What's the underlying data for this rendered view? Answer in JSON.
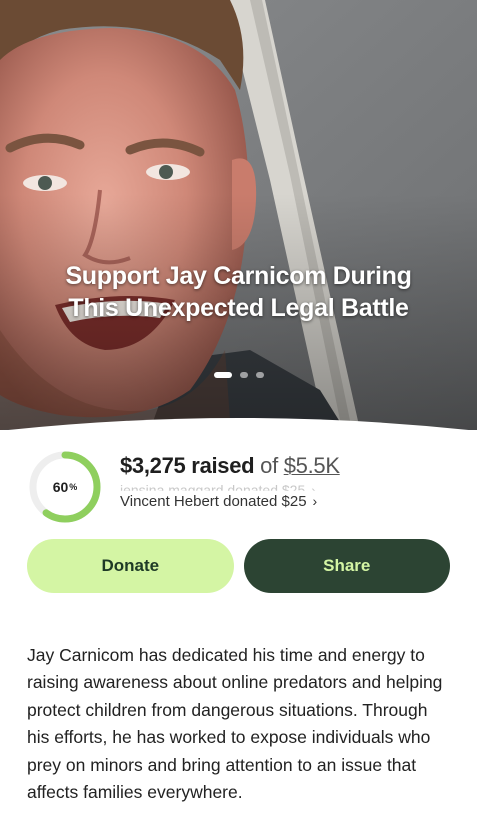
{
  "hero": {
    "title": "Support Jay Carnicom During This Unexpected Legal Battle",
    "slides": 3,
    "active_slide": 0
  },
  "progress": {
    "percent": 60,
    "percent_label": "60",
    "percent_sign": "%",
    "raised": "$3,275 raised",
    "of_label": "of",
    "goal": "$5.5K",
    "ring_color": "#8fcf5e",
    "ring_track_color": "#eeeeee"
  },
  "donations": {
    "previous": "jensina maggard donated $25",
    "current": "Vincent Hebert donated $25"
  },
  "actions": {
    "donate_label": "Donate",
    "share_label": "Share",
    "donate_color": "#d4f5a4",
    "share_color": "#2c4433"
  },
  "story": {
    "text": "Jay Carnicom has dedicated his time and energy to raising awareness about online predators and helping protect children from dangerous situations. Through his efforts, he has worked to expose individuals who prey on minors and bring attention to an issue that affects families everywhere."
  },
  "icons": {
    "chevron": "chevron-right-icon",
    "photo": "hero-photo"
  }
}
